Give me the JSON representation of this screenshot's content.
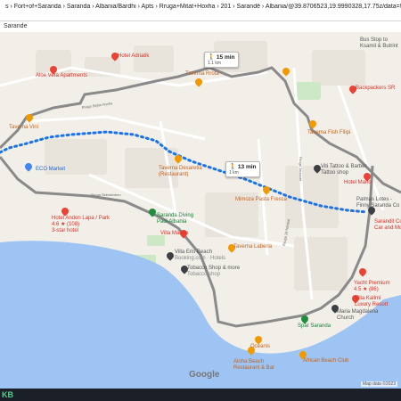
{
  "browser": {
    "url": "s › Fort+of+Saranda › Saranda › Albania/Bardhi › Apts › Rruga+Mitat+Hoxha › 201 › Sarandë › Albania/@39.8706523,19.9990328,17.75z/data=!4m14!4m13!1m5!1m1!1s0x135a14fc9d",
    "subtitle": "Sarande"
  },
  "map": {
    "route_times": [
      {
        "time": "15 min",
        "dist": "1.1 km"
      },
      {
        "time": "13 min",
        "dist": "1 km"
      }
    ],
    "places": [
      {
        "name": "Hotel Adriatik",
        "style": "red"
      },
      {
        "name": "Aloe Vera Apartments",
        "style": "red"
      },
      {
        "name": "Taverna Rrota",
        "style": "orange"
      },
      {
        "name": "Bus Stop to\nKsamil & Butrint",
        "style": "dark"
      },
      {
        "name": "Backpackers SR",
        "style": "red"
      },
      {
        "name": "Taverna Fish Filipi",
        "style": "orange"
      },
      {
        "name": "Viti Tattoo & Barber\nTattoo shop",
        "style": "dark"
      },
      {
        "name": "Hotel Mario",
        "style": "red"
      },
      {
        "name": "Taverna Desaretia\n(Restaurant)",
        "style": "orange"
      },
      {
        "name": "Mimoza Pasta Fresca",
        "style": "orange"
      },
      {
        "name": "ECO Market",
        "style": "blue"
      },
      {
        "name": "Taverna Vini",
        "style": "orange"
      },
      {
        "name": "Saranda Diving\nPadi Albania",
        "style": "green"
      },
      {
        "name": "Hotel Andon Lapa / Park\n4.6 ★ (108)\n3-star hotel",
        "style": "red"
      },
      {
        "name": "Villa Marino",
        "style": "red"
      },
      {
        "name": "Villa Eris Beach",
        "style": "dark"
      },
      {
        "name": "Booking.com · Hotels",
        "style": "gray"
      },
      {
        "name": "Tobacco Shop & more",
        "style": "dark"
      },
      {
        "name": "Tobacco shop",
        "style": "gray"
      },
      {
        "name": "Taverna Laberia",
        "style": "orange"
      },
      {
        "name": "Yacht Premium\n4.5 ★ (86)",
        "style": "red"
      },
      {
        "name": "Villa Kallmi\nLuxury Resort",
        "style": "red"
      },
      {
        "name": "Maria Magdalena\nChurch",
        "style": "dark"
      },
      {
        "name": "Spar Saranda",
        "style": "green"
      },
      {
        "name": "Oceanis",
        "style": "orange"
      },
      {
        "name": "Aloha Beach\nRestaurant & Bar",
        "style": "orange"
      },
      {
        "name": "African Beach Club",
        "style": "orange"
      },
      {
        "name": "Palmas Lotes -\nFinny Saranda Co",
        "style": "dark"
      },
      {
        "name": "Sarandit Co\nCar and Mo",
        "style": "red"
      },
      {
        "name": "Rruga Skënderbeu",
        "style": "road"
      },
      {
        "name": "Rruga Mitat Hoxha",
        "style": "road"
      },
      {
        "name": "Rruga Jonianët",
        "style": "road"
      },
      {
        "name": "Rruga 28 Nëntori",
        "style": "road"
      }
    ],
    "brand": "Google",
    "attribution": "Map data ©2023",
    "colors": {
      "water": "#9dc4f2",
      "route": "#8a8a8a",
      "walk": "#1a73e8",
      "land": "#f2efe9"
    }
  },
  "taskbar": {
    "app_label": "KB"
  }
}
